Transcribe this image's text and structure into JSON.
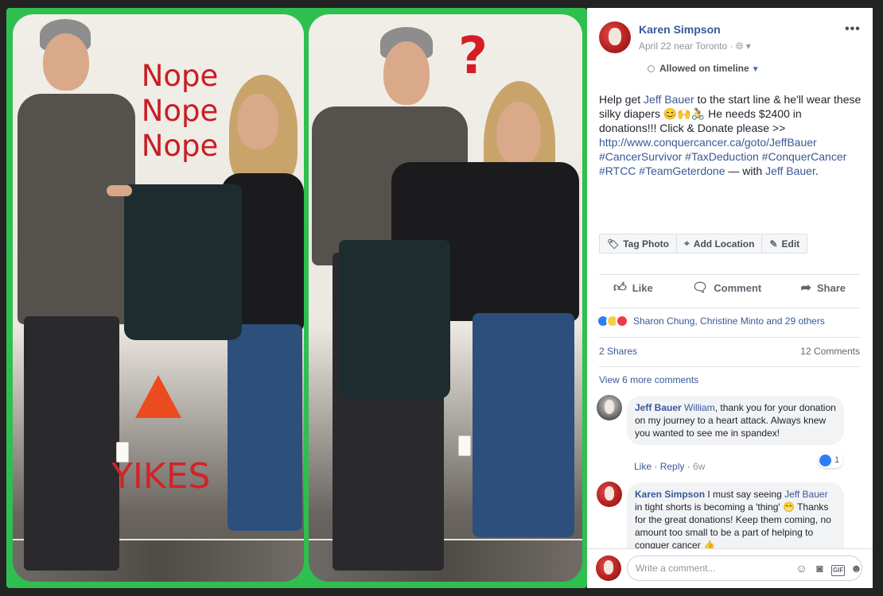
{
  "photo": {
    "overlay_lines": [
      "Nope",
      "Nope",
      "Nope"
    ],
    "question_mark": "?",
    "yikes": "YIKES",
    "colors": {
      "frame": "#2fbf4f",
      "text_red": "#c81e24",
      "triangle": "#ec4a1f"
    }
  },
  "post": {
    "author": "Karen Simpson",
    "meta": "April 22 near Toronto · ",
    "privacy_icon": "globe-icon",
    "more_icon": "ellipsis-icon",
    "more_label": "•••",
    "allowed_label": "Allowed on timeline",
    "text": {
      "p1": "Help get ",
      "mention1": "Jeff Bauer",
      "p2": " to the start line & he'll wear these silky diapers 😊🙌🚴 He needs $2400 in donations!!! Click & Donate please >> ",
      "link": "http://www.conquercancer.ca/goto/JeffBauer",
      "hashtags": "#CancerSurvivor #TaxDeduction #ConquerCancer #RTCC #TeamGeterdone",
      "with_text": " — with ",
      "mention2": "Jeff Bauer",
      "period": "."
    },
    "toolbar": [
      {
        "icon": "tag-icon",
        "glyph": "🏷",
        "label": "Tag Photo"
      },
      {
        "icon": "location-icon",
        "glyph": "📍",
        "label": "Add Location"
      },
      {
        "icon": "pencil-icon",
        "glyph": "✎",
        "label": "Edit"
      }
    ],
    "actions": {
      "like": "Like",
      "comment": "Comment",
      "share": "Share"
    },
    "reactions_summary": "Sharon Chung, Christine Minto and 29 others",
    "shares": "2 Shares",
    "comments_count": "12 Comments",
    "view_more": "View 6 more comments"
  },
  "comments": [
    {
      "author": "Jeff Bauer",
      "mention": "William",
      "text": ", thank you for your donation on my journey to a heart attack. Always knew you wanted to see me in spandex!",
      "like": "Like",
      "reply": "Reply",
      "age": "6w",
      "reaction_count": "1"
    },
    {
      "author": "Karen Simpson",
      "text_a": " I must say seeing ",
      "mention": "Jeff Bauer",
      "text_b": " in tight shorts is becoming a 'thing' 😁 Thanks for the great donations! Keep them coming, no amount too small to be a part of helping to conquer cancer 👍"
    }
  ],
  "composer": {
    "placeholder": "Write a comment...",
    "icons": [
      "emoji-icon",
      "camera-icon",
      "gif-icon",
      "sticker-icon"
    ],
    "gif_label": "GIF"
  }
}
